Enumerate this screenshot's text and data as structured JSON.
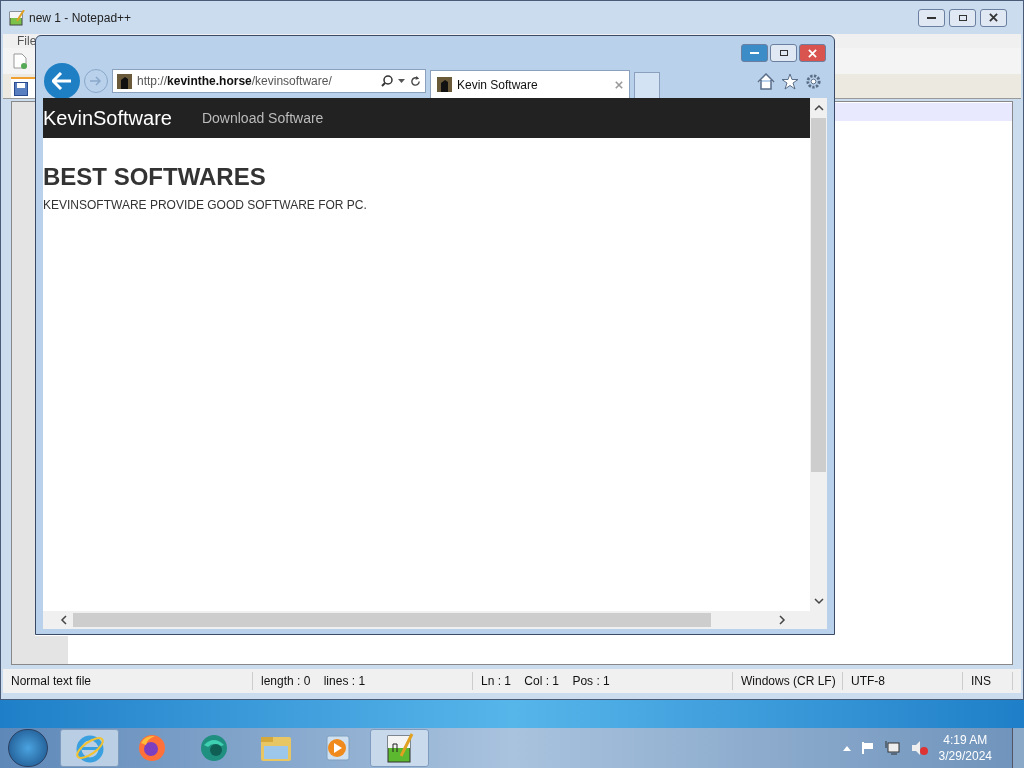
{
  "notepad": {
    "title": "new 1 - Notepad++",
    "menu": [
      "File"
    ],
    "status_bar": [
      "Normal text file",
      "length : 0    lines : 1",
      "Ln : 1    Col : 1    Pos : 1",
      "Windows (CR LF)",
      "UTF-8",
      "INS"
    ]
  },
  "browser": {
    "address": "http://**kevinthe.horse**/kevinsoftware/",
    "tabs": [
      {
        "label": "Kevin Software",
        "selected": true
      }
    ],
    "page": {
      "brand": "KevinSoftware",
      "nav": [
        "Download Software"
      ],
      "heading": "BEST SOFTWARES",
      "text": "KEVINSOFTWARE PROVIDE GOOD SOFTWARE FOR PC."
    }
  },
  "taskbar": {
    "items": [
      {
        "kind": "ie",
        "selected": true
      },
      {
        "kind": "firefox",
        "selected": false
      },
      {
        "kind": "orb",
        "selected": false
      },
      {
        "kind": "explorer",
        "selected": false
      },
      {
        "kind": "media",
        "selected": false
      },
      {
        "kind": "notepad",
        "selected": true
      }
    ],
    "time": "4:19 AM",
    "date": "3/29/2024"
  }
}
